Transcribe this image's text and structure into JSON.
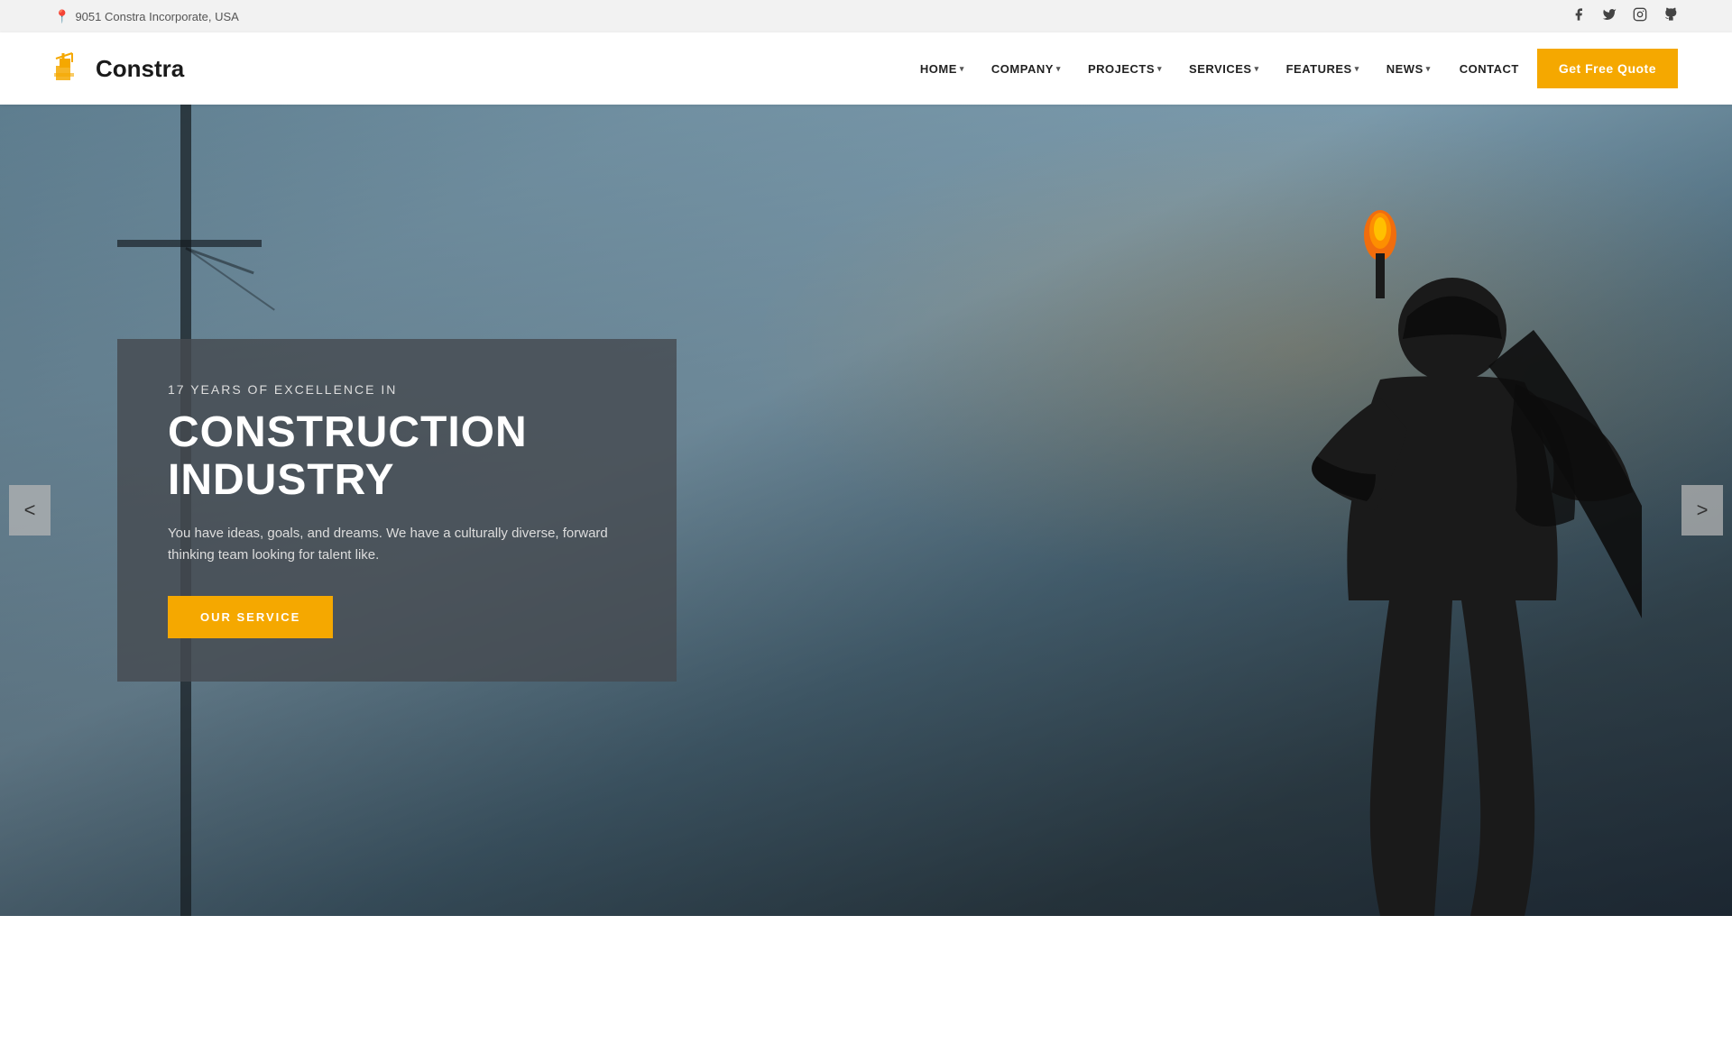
{
  "topbar": {
    "address": "9051 Constra Incorporate, USA",
    "social": [
      {
        "name": "facebook",
        "icon": "f",
        "label": "Facebook"
      },
      {
        "name": "twitter",
        "icon": "t",
        "label": "Twitter"
      },
      {
        "name": "instagram",
        "icon": "in",
        "label": "Instagram"
      },
      {
        "name": "github",
        "icon": "gh",
        "label": "GitHub"
      }
    ]
  },
  "header": {
    "logo_text": "Constra",
    "nav": [
      {
        "label": "HOME",
        "has_dropdown": true
      },
      {
        "label": "COMPANY",
        "has_dropdown": true
      },
      {
        "label": "PROJECTS",
        "has_dropdown": true
      },
      {
        "label": "SERVICES",
        "has_dropdown": true
      },
      {
        "label": "FEATURES",
        "has_dropdown": true
      },
      {
        "label": "NEWS",
        "has_dropdown": true
      },
      {
        "label": "CONTACT",
        "has_dropdown": false
      }
    ],
    "cta_label": "Get Free Quote"
  },
  "hero": {
    "subtitle": "17 YEARS OF EXCELLENCE IN",
    "title": "CONSTRUCTION INDUSTRY",
    "description": "You have ideas, goals, and dreams. We have a culturally diverse, forward thinking team looking for talent like.",
    "cta_label": "OUR SERVICE",
    "slider_prev": "<",
    "slider_next": ">"
  },
  "colors": {
    "accent": "#f5a800",
    "dark": "#1a1a1a",
    "hero_overlay": "rgba(70,75,80,0.82)"
  }
}
